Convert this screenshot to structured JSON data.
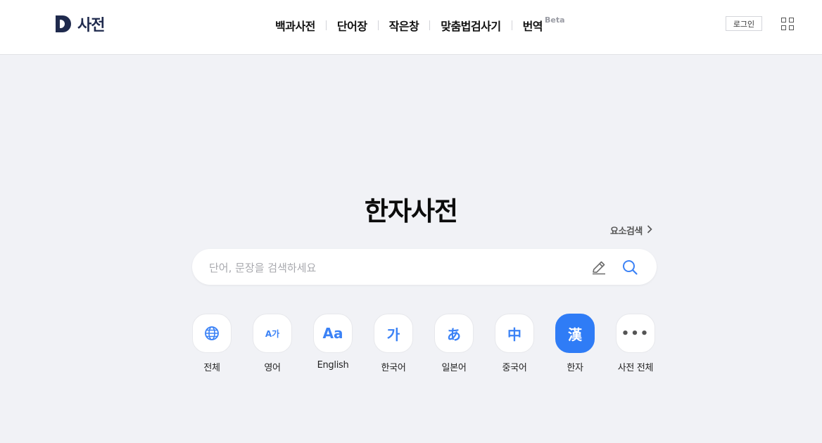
{
  "header": {
    "logo_letter": "D",
    "logo_text": "사전",
    "nav": [
      "백과사전",
      "단어장",
      "작은창",
      "맞춤법검사기",
      "번역"
    ],
    "nav_badge": "Beta",
    "login_label": "로그인",
    "apps_icon": "grid-icon"
  },
  "main": {
    "title": "한자사전",
    "element_search_label": "요소검색",
    "search_placeholder": "단어, 문장을 검색하세요",
    "categories": [
      {
        "icon": "globe-icon",
        "glyph": "",
        "label": "전체"
      },
      {
        "icon": "english-korean-icon",
        "glyph": "A가",
        "label": "영어"
      },
      {
        "icon": "english-icon",
        "glyph": "Aa",
        "label": "English"
      },
      {
        "icon": "korean-icon",
        "glyph": "가",
        "label": "한국어"
      },
      {
        "icon": "japanese-icon",
        "glyph": "あ",
        "label": "일본어"
      },
      {
        "icon": "chinese-icon",
        "glyph": "中",
        "label": "중국어"
      },
      {
        "icon": "hanja-icon",
        "glyph": "漢",
        "label": "한자",
        "active": true
      },
      {
        "icon": "more-icon",
        "glyph": "•••",
        "label": "사전 전체"
      }
    ]
  },
  "colors": {
    "accent": "#2f7cf6",
    "logo": "#1f2a4d",
    "background": "#f1f2f6"
  }
}
